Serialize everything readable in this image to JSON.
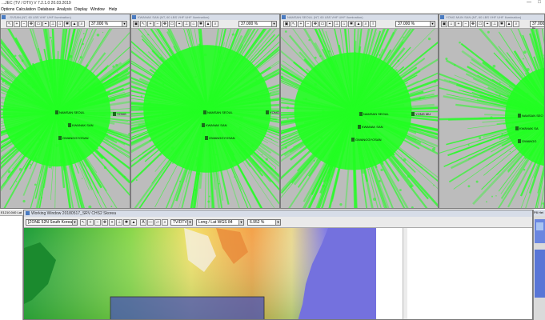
{
  "app": {
    "title": "...JEC (TV / DTV)  V 7.2.1.0  20.03.2019",
    "window_controls": [
      "—",
      "□"
    ]
  },
  "menu": [
    "Options",
    "Calculation",
    "Database",
    "Analysis",
    "Display",
    "Window",
    "Help"
  ],
  "map_windows": [
    {
      "title": "...SVSAN (NT, 60 LBS VHF UHF Ilumination)",
      "zoom": "37.000 %",
      "stations": [
        "NAMSAN SEOUL",
        "YONG",
        "KWANAK SAN",
        "GWANGGYOSAN"
      ]
    },
    {
      "title": "KWANAK SAN (NT, 60 LBS VHF UHF Ilumination)",
      "zoom": "37.000 %",
      "stations": [
        "NAMSAN SEOUL",
        "YONG",
        "KWANAK SAN",
        "GWANGGYOSAN"
      ]
    },
    {
      "title": "NAMSAN SEOUL (NT, 60 LBS VHF UHF Ilumination)",
      "zoom": "37.000 %",
      "stations": [
        "NAMSAN SEOUL",
        "YONG MU",
        "KWANAK SAN",
        "GWANGGYOSAN"
      ]
    },
    {
      "title": "YONG MUN SAN (NT, 60 LBS VHF UHF Ilumination)",
      "zoom": "37.000 %",
      "stations": [
        "NAMSAN SEO",
        "KWANAK SA",
        "GWANGG"
      ]
    }
  ],
  "working_window": {
    "title": "Working Window   20180517_SRV CHS2 Skorea",
    "region_select": "[ZONE 52N  South Korea",
    "layer_select": "TV/DTV",
    "coord_select": "Long / Lat WGS 84",
    "zoom": "6.952 %"
  },
  "left_panel": {
    "header": "E1210.040 Lat"
  },
  "right_panel": {
    "header": "P8 Hei"
  },
  "colors": {
    "coverage": "#22ff22",
    "map_bg": "#bcbcbc",
    "title_bg": "#d7dde8"
  }
}
